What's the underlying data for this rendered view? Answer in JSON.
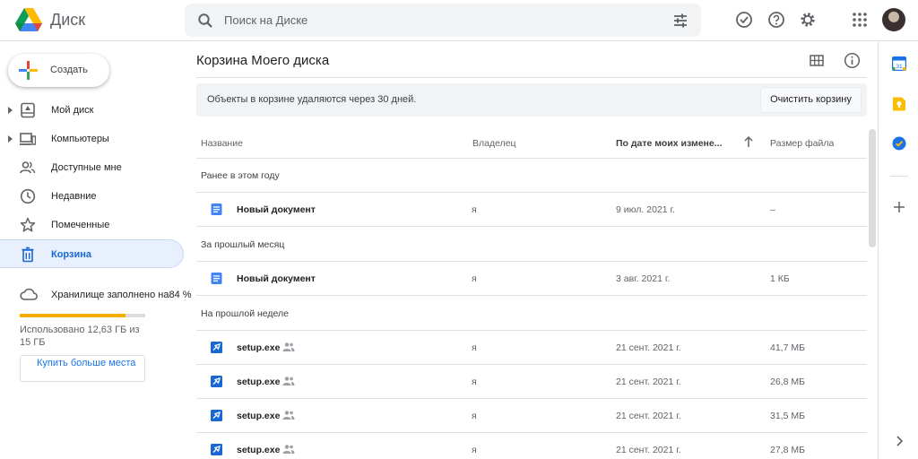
{
  "header": {
    "app_name": "Диск",
    "search_placeholder": "Поиск на Диске"
  },
  "sidebar": {
    "create_label": "Создать",
    "items": [
      {
        "label": "Мой диск",
        "icon": "my-drive-icon",
        "expandable": true
      },
      {
        "label": "Компьютеры",
        "icon": "computers-icon",
        "expandable": true
      },
      {
        "label": "Доступные мне",
        "icon": "shared-with-me-icon",
        "expandable": false
      },
      {
        "label": "Недавние",
        "icon": "clock-icon",
        "expandable": false
      },
      {
        "label": "Помеченные",
        "icon": "star-icon",
        "expandable": false
      },
      {
        "label": "Корзина",
        "icon": "trash-icon",
        "expandable": false,
        "active": true
      }
    ],
    "storage": {
      "title": "Хранилище заполнено на84 %",
      "used_fraction": 0.84,
      "used_text": "Использовано 12,63 ГБ из 15 ГБ",
      "buy_label": "Купить больше места"
    }
  },
  "main": {
    "title": "Корзина Моего диска",
    "banner_text": "Объекты в корзине удаляются через 30 дней.",
    "empty_trash_label": "Очистить корзину",
    "columns": {
      "name": "Название",
      "owner": "Владелец",
      "date": "По дате моих измене...",
      "size": "Размер файла"
    },
    "sections": [
      {
        "title": "Ранее в этом году",
        "rows": [
          {
            "name": "Новый документ",
            "type": "doc",
            "owner": "я",
            "date": "9 июл. 2021 г.",
            "size": "–",
            "shared": false
          }
        ]
      },
      {
        "title": "За прошлый месяц",
        "rows": [
          {
            "name": "Новый документ",
            "type": "doc",
            "owner": "я",
            "date": "3 авг. 2021 г.",
            "size": "1 КБ",
            "shared": false
          }
        ]
      },
      {
        "title": "На прошлой неделе",
        "rows": [
          {
            "name": "setup.exe",
            "type": "exe",
            "owner": "я",
            "date": "21 сент. 2021 г.",
            "size": "41,7 МБ",
            "shared": true
          },
          {
            "name": "setup.exe",
            "type": "exe",
            "owner": "я",
            "date": "21 сент. 2021 г.",
            "size": "26,8 МБ",
            "shared": true
          },
          {
            "name": "setup.exe",
            "type": "exe",
            "owner": "я",
            "date": "21 сент. 2021 г.",
            "size": "31,5 МБ",
            "shared": true
          },
          {
            "name": "setup.exe",
            "type": "exe",
            "owner": "я",
            "date": "21 сент. 2021 г.",
            "size": "27,8 МБ",
            "shared": true
          }
        ]
      }
    ]
  },
  "colors": {
    "accent": "#1a73e8",
    "active_bg": "#e8f0fe",
    "storage_fill": "#f9ab00",
    "doc_blue": "#4285f4",
    "exe_blue": "#1967d2"
  }
}
